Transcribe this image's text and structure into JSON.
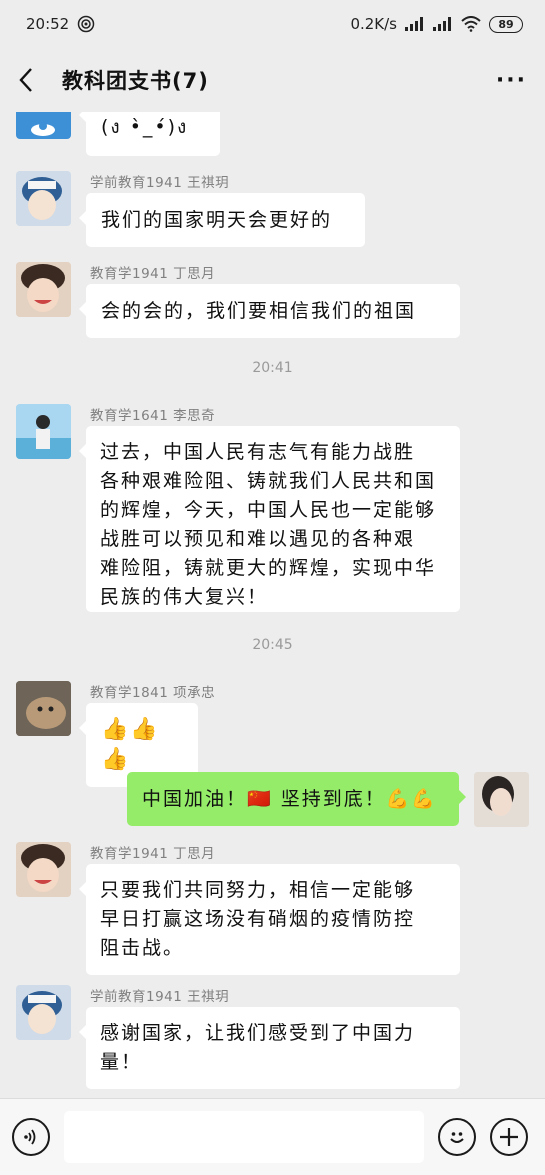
{
  "status_bar": {
    "time": "20:52",
    "net_speed": "0.2K/s",
    "battery": "89"
  },
  "header": {
    "title": "教科团支书(7)",
    "more": "···"
  },
  "messages": {
    "partial_top_text": "(ง •̀_•́)ง",
    "m1": {
      "sender": "学前教育1941 王祺玥",
      "text": "我们的国家明天会更好的"
    },
    "m2": {
      "sender": "教育学1941 丁思月",
      "text": "会的会的，我们要相信我们的祖国"
    },
    "ts1": "20:41",
    "m3": {
      "sender": "教育学1641 李思奇",
      "lines": [
        "过去，中国人民有志气有能力战胜",
        "各种艰难险阻、铸就我们人民共和国",
        "的辉煌，今天，中国人民也一定能够",
        "战胜可以预见和难以遇见的各种艰",
        "难险阻，铸就更大的辉煌，实现中华",
        "民族的伟大复兴！"
      ]
    },
    "ts2": "20:45",
    "m4": {
      "sender": "教育学1841 项承忠",
      "emoji": "👍👍👍"
    },
    "m5": {
      "text_a": "中国加油！",
      "flag": "🇨🇳",
      "text_b": " 坚持到底！",
      "emoji": "💪💪"
    },
    "m6": {
      "sender": "教育学1941 丁思月",
      "lines": [
        "只要我们共同努力，相信一定能够",
        "早日打赢这场没有硝烟的疫情防控",
        "阻击战。"
      ]
    },
    "m7": {
      "sender": "学前教育1941 王祺玥",
      "lines": [
        "感谢国家，让我们感受到了中国力",
        "量！"
      ]
    }
  },
  "input_bar": {
    "voice_icon": "voice-icon",
    "emoji_icon": "emoji-icon",
    "plus_icon": "plus-icon"
  },
  "colors": {
    "background": "#ededed",
    "bubble_self": "#95ec69",
    "bubble_other": "#ffffff"
  }
}
